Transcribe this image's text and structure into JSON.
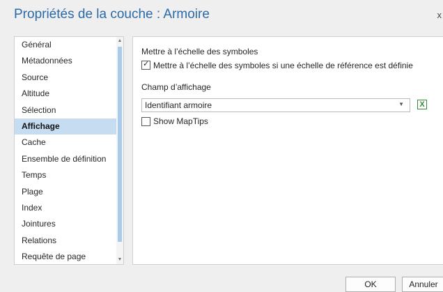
{
  "dialog": {
    "title": "Propriétés de la couche : Armoire",
    "close_glyph": "x"
  },
  "sidebar": {
    "items": [
      {
        "label": "Général"
      },
      {
        "label": "Métadonnées"
      },
      {
        "label": "Source"
      },
      {
        "label": "Altitude"
      },
      {
        "label": "Sélection"
      },
      {
        "label": "Affichage",
        "selected": true
      },
      {
        "label": "Cache"
      },
      {
        "label": "Ensemble de définition"
      },
      {
        "label": "Temps"
      },
      {
        "label": "Plage"
      },
      {
        "label": "Index"
      },
      {
        "label": "Jointures"
      },
      {
        "label": "Relations"
      },
      {
        "label": "Requête de page"
      }
    ]
  },
  "content": {
    "scale_section_label": "Mettre à l’échelle des symboles",
    "scale_checkbox": {
      "label": "Mettre à l’échelle des symboles si une échelle de référence est définie",
      "checked": true
    },
    "display_field_label": "Champ d’affichage",
    "display_field_value": "Identifiant armoire",
    "maptips_checkbox": {
      "label": "Show MapTips",
      "checked": false
    }
  },
  "footer": {
    "ok_label": "OK",
    "cancel_label": "Annuler"
  },
  "colors": {
    "title": "#2a6aa8",
    "selected_item_bg": "#c6dcf1",
    "scroll_thumb": "#a9cbec",
    "expression_icon": "#2e8b3a"
  }
}
